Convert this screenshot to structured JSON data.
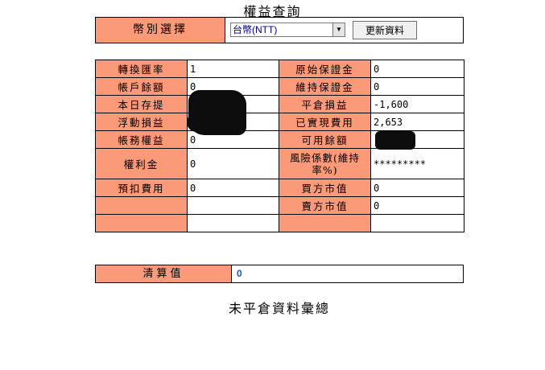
{
  "page": {
    "title": "權益查詢",
    "section_title": "未平倉資料彙總"
  },
  "currency": {
    "label": "幣別選擇",
    "selected": "台幣(NTT)",
    "refresh_button": "更新資料"
  },
  "grid": {
    "left": [
      {
        "label": "轉換匯率",
        "value": "1"
      },
      {
        "label": "帳戶餘額",
        "value": "0"
      },
      {
        "label": "本日存提",
        "value": ""
      },
      {
        "label": "浮動損益",
        "value": ""
      },
      {
        "label": "帳務權益",
        "value": "0"
      },
      {
        "label": "權利金",
        "value": "0"
      },
      {
        "label": "預扣費用",
        "value": "0"
      },
      {
        "label": "",
        "value": ""
      },
      {
        "label": "",
        "value": ""
      }
    ],
    "right": [
      {
        "label": "原始保證金",
        "value": "0"
      },
      {
        "label": "維持保證金",
        "value": "0"
      },
      {
        "label": "平倉損益",
        "value": "-1,600"
      },
      {
        "label": "已實現費用",
        "value": "2,653"
      },
      {
        "label": "可用餘額",
        "value": ""
      },
      {
        "label": "風險係數(維持率%)",
        "value": "*********"
      },
      {
        "label": "買方市值",
        "value": "0"
      },
      {
        "label": "賣方市值",
        "value": "0"
      },
      {
        "label": "",
        "value": ""
      }
    ]
  },
  "settlement": {
    "label": "清算值",
    "value": "0",
    "value_color": "#1a52c8"
  },
  "colors": {
    "label_bg": "#fa9a78",
    "redaction": "#0d0d0d"
  }
}
